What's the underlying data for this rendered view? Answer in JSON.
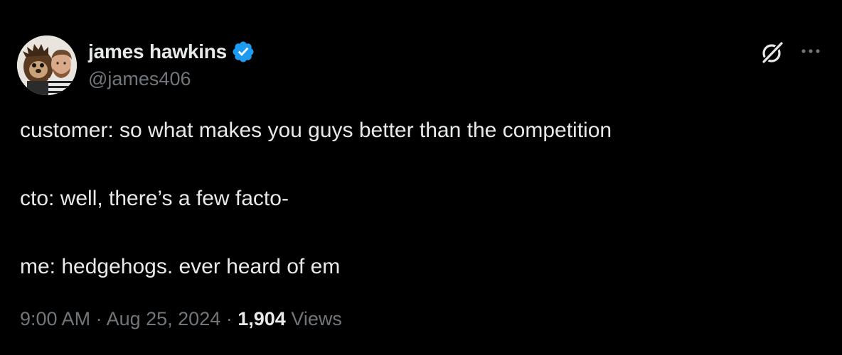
{
  "author": {
    "display_name": "james hawkins",
    "handle": "@james406",
    "verified": true,
    "avatar_icon": "avatar-photo"
  },
  "actions": {
    "grok_icon": "grok-icon",
    "more_icon": "more-horizontal-icon"
  },
  "tweet": {
    "lines": [
      "customer: so what makes you guys better than the competition",
      "cto: well, there’s a few facto-",
      "me: hedgehogs. ever heard of em"
    ]
  },
  "meta": {
    "time": "9:00 AM",
    "separator1": " · ",
    "date": "Aug 25, 2024",
    "separator2": " · ",
    "views_count": "1,904",
    "views_label": "Views"
  },
  "colors": {
    "background": "#000000",
    "text_primary": "#e7e9ea",
    "text_secondary": "#71767b",
    "verified_blue": "#1d9bf0"
  }
}
